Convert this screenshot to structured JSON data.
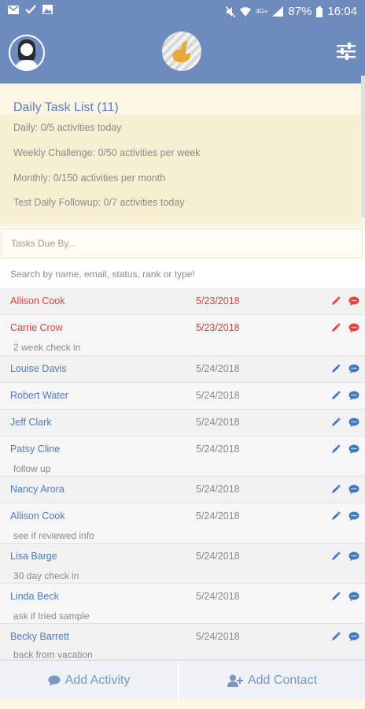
{
  "status_bar": {
    "battery": "87%",
    "time": "16:04",
    "network": "4G+"
  },
  "header": {
    "avatar_icon": "user-avatar-icon",
    "logo_icon": "app-logo-icon",
    "filter_icon": "sliders-icon"
  },
  "goals": {
    "title": "Daily Task List (11)",
    "items": [
      "Daily: 0/5 activities today",
      "Weekly Challenge: 0/50 activities per week",
      "Monthly: 0/150 activities per month",
      "Test Daily Followup: 0/7 activities today"
    ]
  },
  "due_field": {
    "placeholder": "Tasks Due By..."
  },
  "search": {
    "placeholder": "Search by name, email, status, rank or type!"
  },
  "colors": {
    "primary": "#6d8bbd",
    "overdue": "#e0423d",
    "link": "#4d7cc0",
    "panel": "#fbf7e4"
  },
  "tasks": [
    {
      "name": "Allison Cook",
      "date": "5/23/2018",
      "note": "",
      "overdue": true
    },
    {
      "name": "Carrie Crow",
      "date": "5/23/2018",
      "note": "2 week check in",
      "overdue": true
    },
    {
      "name": "Louise Davis",
      "date": "5/24/2018",
      "note": "",
      "overdue": false
    },
    {
      "name": "Robert Water",
      "date": "5/24/2018",
      "note": "",
      "overdue": false
    },
    {
      "name": "Jeff Clark",
      "date": "5/24/2018",
      "note": "",
      "overdue": false
    },
    {
      "name": "Patsy Cline",
      "date": "5/24/2018",
      "note": "follow up",
      "overdue": false
    },
    {
      "name": "Nancy Arora",
      "date": "5/24/2018",
      "note": "",
      "overdue": false
    },
    {
      "name": "Allison Cook",
      "date": "5/24/2018",
      "note": "see if reviewed info",
      "overdue": false
    },
    {
      "name": "Lisa Barge",
      "date": "5/24/2018",
      "note": "30 day check in",
      "overdue": false
    },
    {
      "name": "Linda Beck",
      "date": "5/24/2018",
      "note": "ask if tried sample",
      "overdue": false
    },
    {
      "name": "Becky Barrett",
      "date": "5/24/2018",
      "note": "back from vacation",
      "overdue": false
    }
  ],
  "actions": {
    "add_activity": "Add Activity",
    "add_contact": "Add Contact"
  }
}
